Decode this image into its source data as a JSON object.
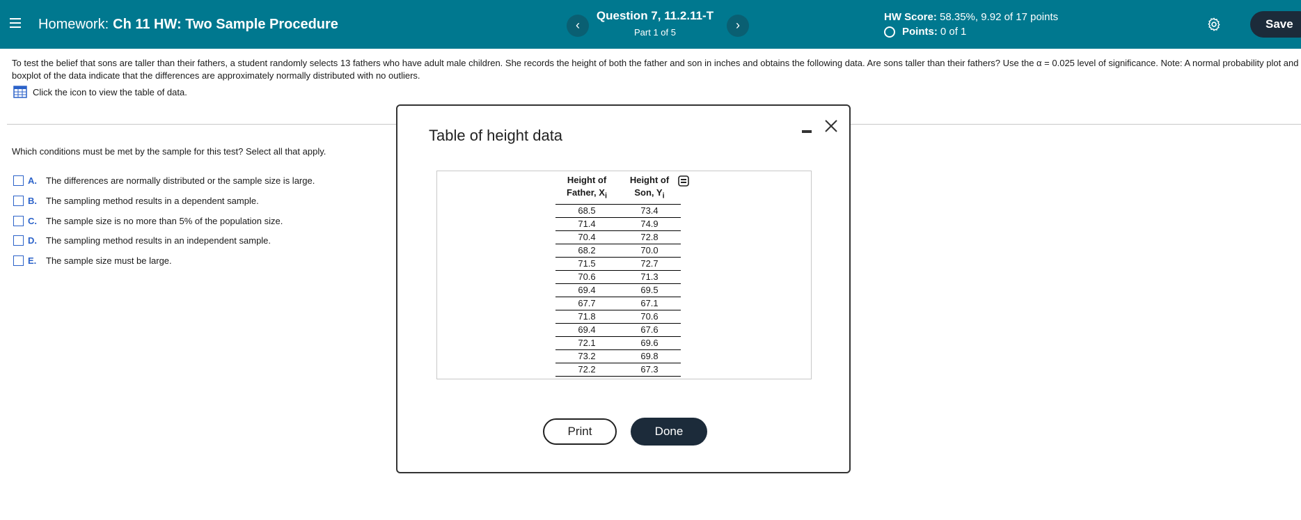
{
  "header": {
    "title_prefix": "Homework:",
    "title_main": "Ch 11 HW: Two Sample Procedure",
    "question_title": "Question 7, 11.2.11-T",
    "question_part": "Part 1 of 5",
    "score_label": "HW Score:",
    "score_value": "58.35%, 9.92 of 17 points",
    "points_label": "Points:",
    "points_value": "0 of 1",
    "save_label": "Save",
    "prev_glyph": "‹",
    "next_glyph": "›"
  },
  "prompt": {
    "text": "To test the belief that sons are taller than their fathers, a student randomly selects 13 fathers who have adult male children. She records the height of both the father and son in inches and obtains the following data. Are sons taller than their fathers? Use the α = 0.025 level of significance. Note: A normal probability plot and boxplot of the data indicate that the differences are approximately normally distributed with no outliers.",
    "table_link": "Click the icon to view the table of data."
  },
  "question": {
    "text": "Which conditions must be met by the sample for this test? Select all that apply.",
    "choices": [
      {
        "letter": "A.",
        "text": "The differences are normally distributed or the sample size is large."
      },
      {
        "letter": "B.",
        "text": "The sampling method results in a dependent sample."
      },
      {
        "letter": "C.",
        "text": "The sample size is no more than 5% of the population size."
      },
      {
        "letter": "D.",
        "text": "The sampling method results in an independent sample."
      },
      {
        "letter": "E.",
        "text": "The sample size must be large."
      }
    ]
  },
  "modal": {
    "title": "Table of height data",
    "col1_line1": "Height of",
    "col1_line2": "Father, X",
    "col2_line1": "Height of",
    "col2_line2": "Son, Y",
    "subscript": "i",
    "rows": [
      [
        "68.5",
        "73.4"
      ],
      [
        "71.4",
        "74.9"
      ],
      [
        "70.4",
        "72.8"
      ],
      [
        "68.2",
        "70.0"
      ],
      [
        "71.5",
        "72.7"
      ],
      [
        "70.6",
        "71.3"
      ],
      [
        "69.4",
        "69.5"
      ],
      [
        "67.7",
        "67.1"
      ],
      [
        "71.8",
        "70.6"
      ],
      [
        "69.4",
        "67.6"
      ],
      [
        "72.1",
        "69.6"
      ],
      [
        "73.2",
        "69.8"
      ],
      [
        "72.2",
        "67.3"
      ]
    ],
    "print_label": "Print",
    "done_label": "Done"
  },
  "colors": {
    "header_bg": "#00788f",
    "accent_blue": "#2b62c9",
    "dark_button": "#1c2b3a"
  },
  "icons": {
    "menu": "hamburger-menu-icon",
    "settings": "gear-icon",
    "table": "table-grid-icon",
    "minimize": "minimize-icon",
    "close": "close-icon",
    "copy": "copy-icon"
  }
}
